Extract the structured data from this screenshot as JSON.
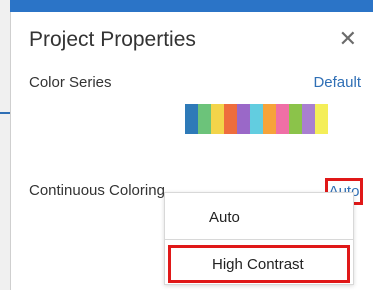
{
  "dialog": {
    "title": "Project Properties",
    "close_glyph": "✕"
  },
  "color_series": {
    "label": "Color Series",
    "value": "Default",
    "swatches": [
      "#2e7ab8",
      "#6cc37a",
      "#f3d44a",
      "#ee6d3d",
      "#9a68c8",
      "#62cde0",
      "#f6a33a",
      "#ef6fa6",
      "#8bc34a",
      "#a97fd0",
      "#f4ee58"
    ]
  },
  "continuous_coloring": {
    "label": "Continuous Coloring",
    "value": "Auto"
  },
  "dropdown": {
    "options": [
      "Auto",
      "High Contrast"
    ]
  },
  "colors": {
    "accent": "#2f6fb5",
    "highlight": "#e01818"
  }
}
